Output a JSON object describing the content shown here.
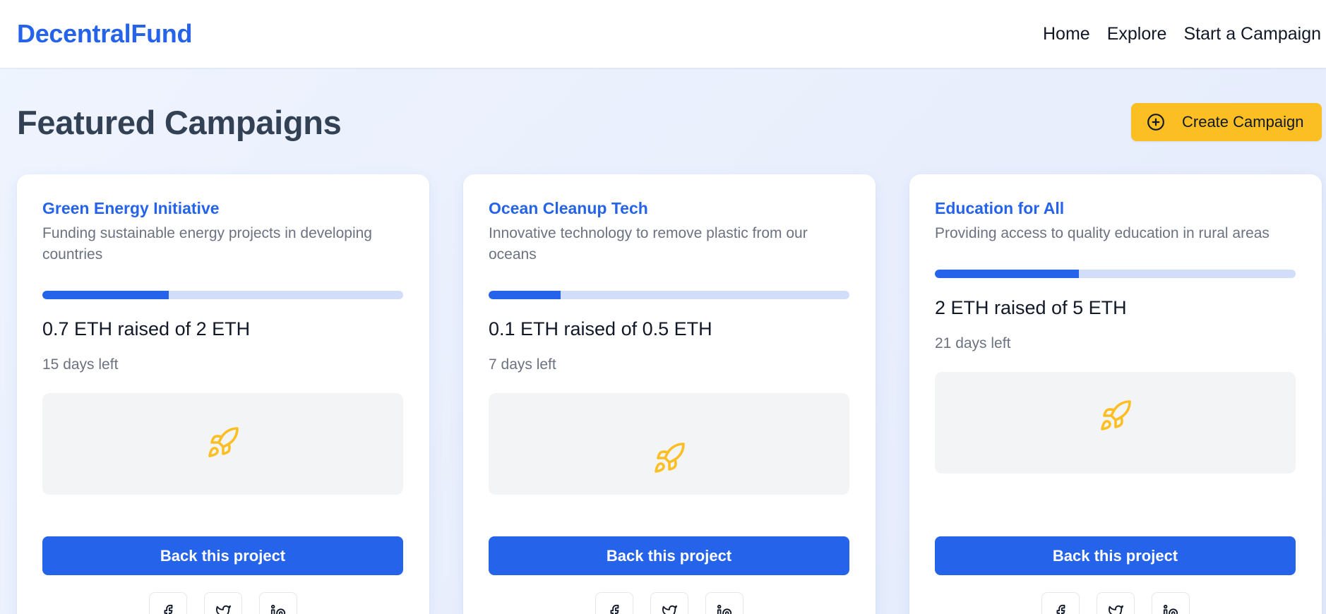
{
  "app": {
    "brand": "DecentralFund"
  },
  "nav": {
    "links": [
      "Home",
      "Explore",
      "Start a Campaign"
    ]
  },
  "page": {
    "title": "Featured Campaigns",
    "create_button": "Create Campaign"
  },
  "colors": {
    "brand": "#2563eb",
    "accent": "#fbbf24",
    "progress_track": "#d2def9"
  },
  "campaigns": [
    {
      "title": "Green Energy Initiative",
      "description": "Funding sustainable energy projects in developing countries",
      "raised_text": "0.7 ETH raised of 2 ETH",
      "progress_fraction": 0.35,
      "days_left": "15 days left",
      "media_icon": "rocket-icon",
      "cta": "Back this project"
    },
    {
      "title": "Ocean Cleanup Tech",
      "description": "Innovative technology to remove plastic from our oceans",
      "raised_text": "0.1 ETH raised of 0.5 ETH",
      "progress_fraction": 0.2,
      "days_left": "7 days left",
      "media_icon": "rocket-icon",
      "cta": "Back this project"
    },
    {
      "title": "Education for All",
      "description": "Providing access to quality education in rural areas",
      "raised_text": "2 ETH raised of 5 ETH",
      "progress_fraction": 0.4,
      "days_left": "21 days left",
      "media_icon": "rocket-icon",
      "cta": "Back this project"
    }
  ],
  "share_icons": [
    "facebook-icon",
    "twitter-icon",
    "linkedin-icon"
  ]
}
